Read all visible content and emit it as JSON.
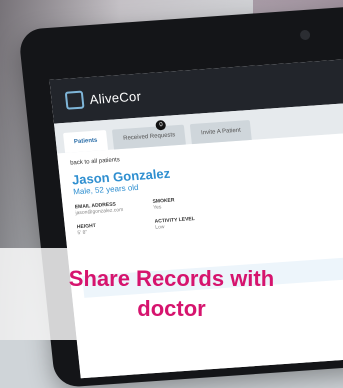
{
  "app": {
    "name": "AliveCor"
  },
  "tabs": [
    {
      "label": "Patients"
    },
    {
      "label": "Received Requests",
      "badge": "0"
    },
    {
      "label": "Invite A Patient"
    }
  ],
  "patient": {
    "back_link": "back to all patients",
    "name": "Jason Gonzalez",
    "subtitle": "Male, 52 years old",
    "fields": {
      "email_label": "EMAIL ADDRESS",
      "email_value": "jason@gonzalez.com",
      "height_label": "HEIGHT",
      "height_value": "5' 8\"",
      "smoker_label": "SMOKER",
      "smoker_value": "Yes",
      "activity_label": "ACTIVITY LEVEL",
      "activity_value": "Low"
    }
  },
  "caption": {
    "line1": "Share Records with",
    "line2": "doctor",
    "color": "#d6146e"
  }
}
